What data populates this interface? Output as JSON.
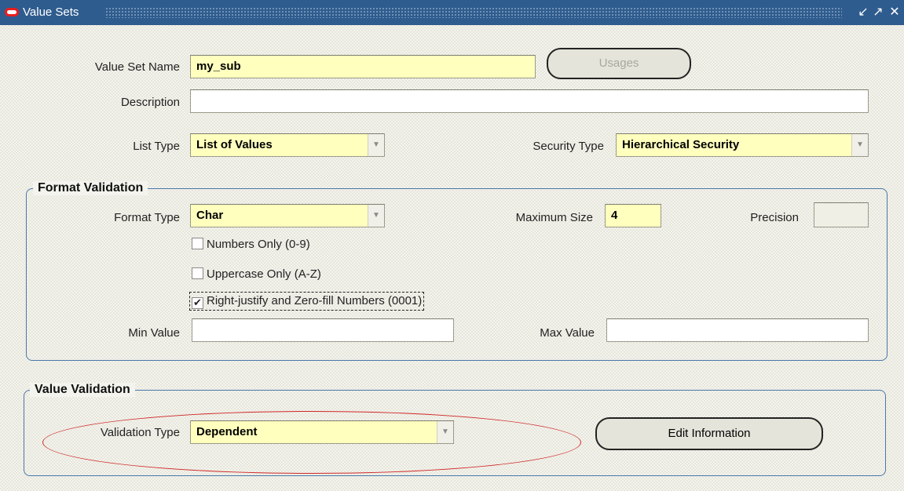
{
  "window": {
    "title": "Value Sets",
    "minimize_label": "↙",
    "maximize_label": "↗",
    "close_label": "✕"
  },
  "header": {
    "value_set_name_label": "Value Set Name",
    "value_set_name_value": "my_sub",
    "usages_label": "Usages",
    "description_label": "Description",
    "description_value": "",
    "list_type_label": "List Type",
    "list_type_value": "List of Values",
    "security_type_label": "Security Type",
    "security_type_value": "Hierarchical Security"
  },
  "format_validation": {
    "title": "Format Validation",
    "format_type_label": "Format Type",
    "format_type_value": "Char",
    "maximum_size_label": "Maximum Size",
    "maximum_size_value": "4",
    "precision_label": "Precision",
    "precision_value": "",
    "numbers_only_label": "Numbers Only (0-9)",
    "numbers_only_checked": false,
    "uppercase_only_label": "Uppercase Only (A-Z)",
    "uppercase_only_checked": false,
    "right_justify_label": "Right-justify and Zero-fill Numbers (0001)",
    "right_justify_checked": true,
    "check_mark": "✔",
    "min_value_label": "Min Value",
    "min_value_value": "",
    "max_value_label": "Max Value",
    "max_value_value": ""
  },
  "value_validation": {
    "title": "Value Validation",
    "validation_type_label": "Validation Type",
    "validation_type_value": "Dependent",
    "edit_information_label": "Edit Information"
  },
  "dropdown_arrow": "▼",
  "colors": {
    "titlebar": "#2f5c8e",
    "required_field": "#ffffbe",
    "annotation": "#d02828",
    "group_border": "#4a78a8"
  }
}
